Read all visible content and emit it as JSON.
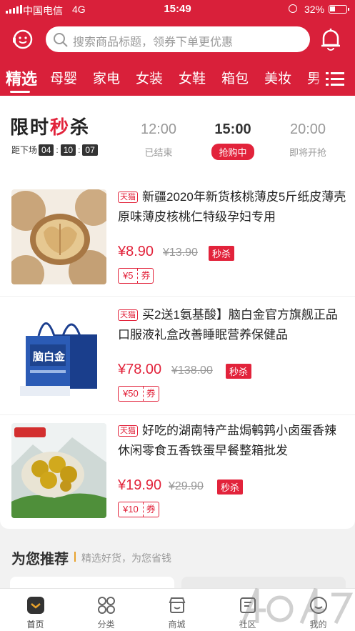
{
  "status_bar": {
    "carrier": "中国电信",
    "network": "4G",
    "time": "15:49",
    "battery": "32%",
    "battery_level": 0.32
  },
  "header": {
    "search_placeholder": "搜索商品标题，领券下单更优惠"
  },
  "categories": [
    "精选",
    "母婴",
    "家电",
    "女装",
    "女鞋",
    "箱包",
    "美妆",
    "男"
  ],
  "flash_sale": {
    "title_a": "限时",
    "title_hi": "秒",
    "title_b": "杀",
    "countdown_label": "距下场",
    "hours": "04",
    "minutes": "10",
    "seconds": "07",
    "slots": [
      {
        "time": "12:00",
        "status": "已结束"
      },
      {
        "time": "15:00",
        "status": "抢购中"
      },
      {
        "time": "20:00",
        "status": "即将开抢"
      }
    ]
  },
  "products": [
    {
      "badge": "天猫",
      "title": "新疆2020年新货核桃薄皮5斤纸皮薄壳原味薄皮核桃仁特级孕妇专用",
      "price": "¥8.90",
      "original_price": "¥13.90",
      "tag": "秒杀",
      "coupon_amount": "¥5",
      "coupon_label": "券"
    },
    {
      "badge": "天猫",
      "title": "买2送1氨基酸】脑白金官方旗舰正品口服液礼盒改善睡眠营养保健品",
      "price": "¥78.00",
      "original_price": "¥138.00",
      "tag": "秒杀",
      "coupon_amount": "¥50",
      "coupon_label": "券",
      "brand_text": "脑白金"
    },
    {
      "badge": "天猫",
      "title": "好吃的湖南特产盐焗鹌鹑小卤蛋香辣休闲零食五香铁蛋早餐整箱批发",
      "price": "¥19.90",
      "original_price": "¥29.90",
      "tag": "秒杀",
      "coupon_amount": "¥10",
      "coupon_label": "券"
    }
  ],
  "recommend": {
    "title": "为您推荐",
    "subtitle": "精选好货，为您省钱"
  },
  "tabbar": [
    "首页",
    "分类",
    "商城",
    "社区",
    "我的"
  ],
  "colors": {
    "primary": "#d9203a",
    "accent": "#e2233b",
    "highlight": "#e8a22c"
  }
}
